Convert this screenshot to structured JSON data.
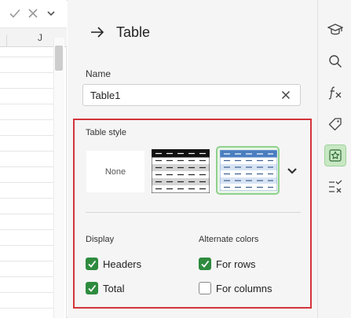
{
  "sheet": {
    "column_letter": "J"
  },
  "panel": {
    "title": "Table",
    "name_label": "Name",
    "name_value": "Table1",
    "table_style_label": "Table style",
    "styles": [
      {
        "label": "None"
      },
      {
        "label": ""
      },
      {
        "label": ""
      }
    ],
    "display_label": "Display",
    "alternate_label": "Alternate colors",
    "checks": {
      "headers": {
        "label": "Headers",
        "checked": true
      },
      "total": {
        "label": "Total",
        "checked": true
      },
      "for_rows": {
        "label": "For rows",
        "checked": true
      },
      "for_columns": {
        "label": "For columns",
        "checked": false
      }
    }
  },
  "rail": {
    "icons": [
      "graduation-cap-icon",
      "search-icon",
      "function-icon",
      "tag-icon",
      "star-icon",
      "checklist-icon"
    ],
    "active": "star-icon"
  },
  "colors": {
    "accent_green": "#2e8b3e",
    "highlight_red": "#d4343b",
    "table_blue": "#4a7ec0"
  }
}
